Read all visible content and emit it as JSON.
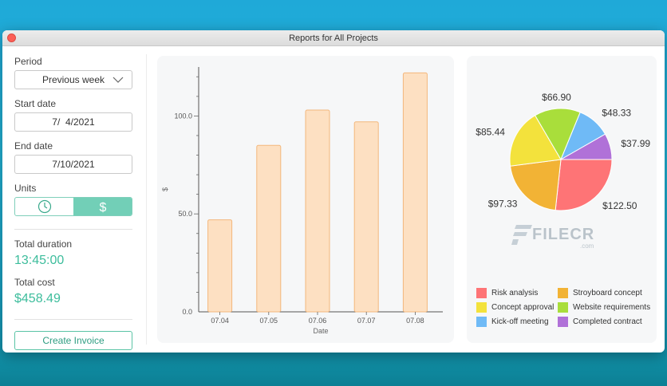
{
  "window": {
    "title": "Reports for All Projects"
  },
  "sidebar": {
    "period_label": "Period",
    "period_value": "Previous week",
    "start_label": "Start date",
    "start_value": "7/  4/2021",
    "end_label": "End date",
    "end_value": "7/10/2021",
    "units_label": "Units",
    "units_selected": "cost",
    "total_duration_label": "Total duration",
    "total_duration_value": "13:45:00",
    "total_cost_label": "Total cost",
    "total_cost_value": "$458.49",
    "create_invoice_label": "Create Invoice"
  },
  "watermark": {
    "text": "FILECR",
    "sub": ".com"
  },
  "colors": {
    "accent": "#3dbd9c",
    "bar_fill": "#fde0c2",
    "bar_stroke": "#f3b77c"
  },
  "chart_data": [
    {
      "type": "bar",
      "categories": [
        "07.04",
        "07.05",
        "07.06",
        "07.07",
        "07.08"
      ],
      "values": [
        47,
        85,
        103,
        97,
        122
      ],
      "xlabel": "Date",
      "ylabel": "$",
      "yticks": [
        "0.0",
        "50.0",
        "100.0"
      ],
      "ylim": [
        0,
        125
      ],
      "grid": false
    },
    {
      "type": "pie",
      "slices": [
        {
          "name": "Risk analysis",
          "value": 122.5,
          "label": "$122.50",
          "color": "#fe7476"
        },
        {
          "name": "Stroyboard concept",
          "value": 97.33,
          "label": "$97.33",
          "color": "#f2b335"
        },
        {
          "name": "Concept approval",
          "value": 85.44,
          "label": "$85.44",
          "color": "#f3e23c"
        },
        {
          "name": "Website requirements",
          "value": 66.9,
          "label": "$66.90",
          "color": "#a9de3b"
        },
        {
          "name": "Kick-off meeting",
          "value": 48.33,
          "label": "$48.33",
          "color": "#6fbaf6"
        },
        {
          "name": "Completed contract",
          "value": 37.99,
          "label": "$37.99",
          "color": "#b071d8"
        }
      ],
      "legend": [
        "Risk analysis",
        "Stroyboard concept",
        "Concept approval",
        "Website requirements",
        "Kick-off meeting",
        "Completed contract"
      ],
      "legend_placement": "bottom"
    }
  ]
}
